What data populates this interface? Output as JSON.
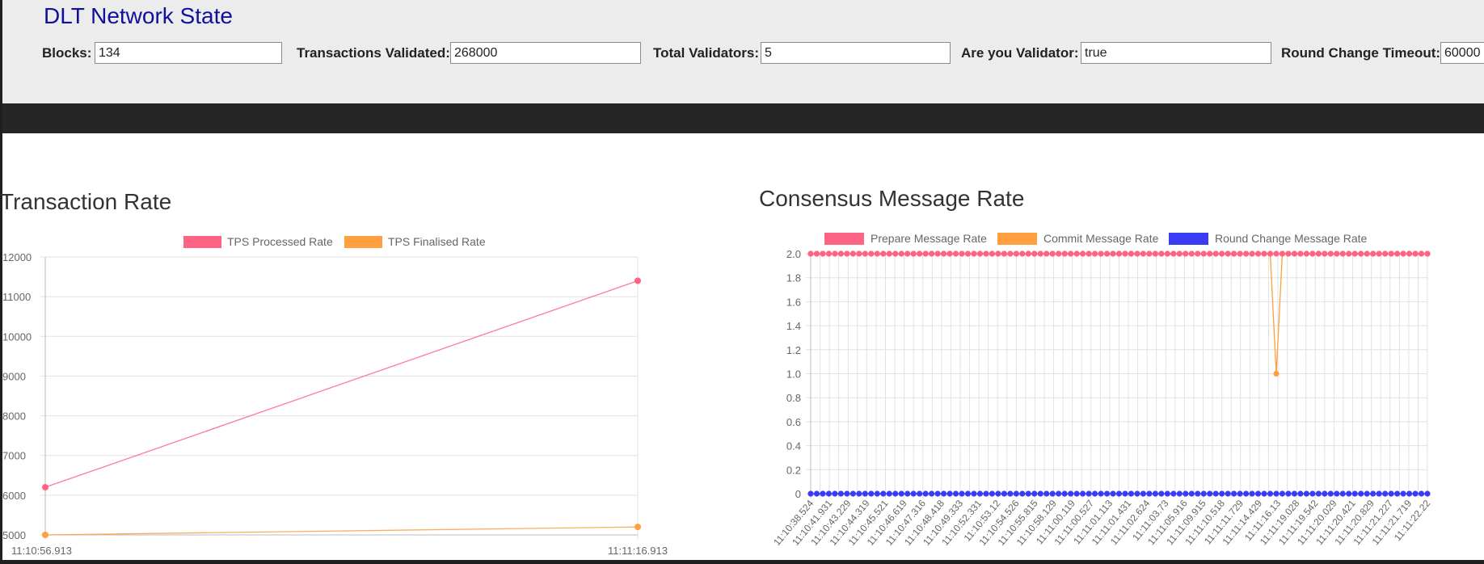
{
  "header": {
    "title": "DLT Network State",
    "fields": [
      {
        "label": "Blocks:",
        "value": "134"
      },
      {
        "label": "Transactions Validated:",
        "value": "268000"
      },
      {
        "label": "Total Validators:",
        "value": "5"
      },
      {
        "label": "Are you Validator:",
        "value": "true"
      },
      {
        "label": "Round Change Timeout:",
        "value": "60000"
      }
    ]
  },
  "chart_data": [
    {
      "type": "line",
      "title": "Transaction Rate",
      "x": [
        "11:10:56.913",
        "11:11:16.913"
      ],
      "series": [
        {
          "name": "TPS Processed Rate",
          "values": [
            6200,
            11400
          ],
          "color": "#ff6384"
        },
        {
          "name": "TPS Finalised Rate",
          "values": [
            5000,
            5200
          ],
          "color": "#ff9f40"
        }
      ],
      "ylim": [
        5000,
        12000
      ],
      "yticks": [
        "5000",
        "6000",
        "7000",
        "8000",
        "9000",
        "10000",
        "11000",
        "12000"
      ],
      "legend": "top",
      "grid": true
    },
    {
      "type": "line",
      "title": "Consensus Message Rate",
      "x": [
        "11:10:38.524",
        "11:10:41.931",
        "11:10:43.229",
        "11:10:44.319",
        "11:10:45.521",
        "11:10:46.619",
        "11:10:47.316",
        "11:10:48.418",
        "11:10:49.333",
        "11:10:52.331",
        "11:10:53.12",
        "11:10:54.526",
        "11:10:55.815",
        "11:10:58.129",
        "11:11:00.119",
        "11:11:00.527",
        "11:11:01.113",
        "11:11:01.431",
        "11:11:02.624",
        "11:11:03.73",
        "11:11:05.916",
        "11:11:09.915",
        "11:11:10.518",
        "11:11:11.729",
        "11:11:14.429",
        "11:11:16.13",
        "11:11:19.028",
        "11:11:19.542",
        "11:11:20.029",
        "11:11:20.421",
        "11:11:20.829",
        "11:11:21.227",
        "11:11:21.719",
        "11:11:22.22"
      ],
      "point_count": 103,
      "series": [
        {
          "name": "Prepare Message Rate",
          "constant": 2,
          "color": "#ff6384"
        },
        {
          "name": "Commit Message Rate",
          "constant": 2,
          "dip_value": 1,
          "dip_position": 0.757,
          "color": "#ff9f40"
        },
        {
          "name": "Round Change Message Rate",
          "constant": 0,
          "color": "#3b3bf5"
        }
      ],
      "ylim": [
        0,
        2
      ],
      "yticks": [
        "0",
        "0.2",
        "0.4",
        "0.6",
        "0.8",
        "1.0",
        "1.2",
        "1.4",
        "1.6",
        "1.8",
        "2.0"
      ],
      "legend": "top",
      "grid": true
    }
  ]
}
